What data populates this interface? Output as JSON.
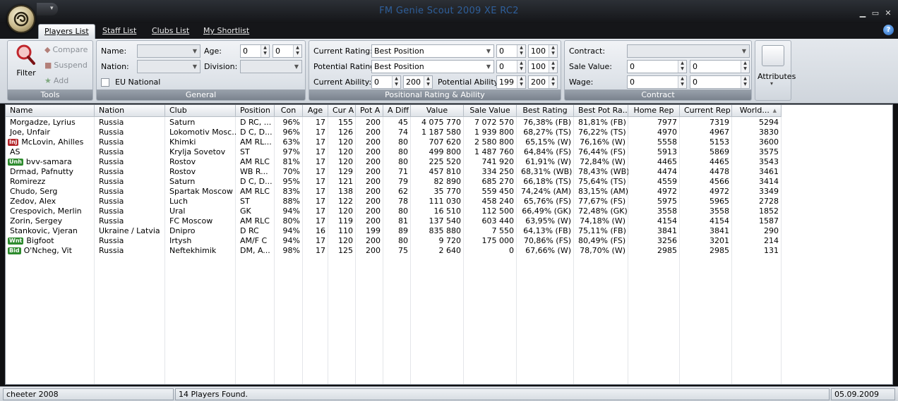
{
  "window": {
    "title": "FM Genie Scout 2009 XE RC2",
    "menu_arrow": "▾",
    "min": "▁",
    "restore": "▭",
    "close": "✕"
  },
  "tabs": [
    {
      "label": "Players List",
      "active": true
    },
    {
      "label": "Staff List"
    },
    {
      "label": "Clubs List"
    },
    {
      "label": "My Shortlist"
    }
  ],
  "help": "?",
  "ribbon": {
    "tools": {
      "caption": "Tools",
      "filter": "Filter",
      "compare": "Compare",
      "suspend": "Suspend",
      "add": "Add"
    },
    "general": {
      "caption": "General",
      "name_label": "Name:",
      "nation_label": "Nation:",
      "eu_label": "EU National",
      "age_label": "Age:",
      "age_min": "0",
      "age_max": "0",
      "division_label": "Division:"
    },
    "positional": {
      "caption": "Positional Rating & Ability",
      "current_rating_label": "Current Rating:",
      "current_rating_value": "Best Position",
      "cr_min": "0",
      "cr_max": "100",
      "potential_rating_label": "Potential Rating:",
      "potential_rating_value": "Best Position",
      "pr_min": "0",
      "pr_max": "100",
      "current_ability_label": "Current Ability:",
      "ca_min": "0",
      "ca_max": "200",
      "potential_ability_label": "Potential Ability:",
      "pa_min": "199",
      "pa_max": "200"
    },
    "contract": {
      "caption": "Contract",
      "contract_label": "Contract:",
      "sale_value_label": "Sale Value:",
      "sv_min": "0",
      "sv_max": "0",
      "wage_label": "Wage:",
      "w_min": "0",
      "w_max": "0"
    },
    "attributes": {
      "label": "Attributes",
      "arrow": "▾"
    }
  },
  "table": {
    "columns": [
      "Name",
      "Nation",
      "Club",
      "Position",
      "Con",
      "Age",
      "Cur A",
      "Pot A",
      "A Diff",
      "Value",
      "Sale Value",
      "Best Rating",
      "Best Pot Ra...",
      "Home Rep",
      "Current Rep",
      "World..."
    ],
    "sort_arrow": "▲",
    "rows": [
      {
        "badge": "",
        "name": "Morgadze, Lyrius",
        "nation": "Russia",
        "club": "Saturn",
        "position": "D RC, ...",
        "con": "96%",
        "age": "17",
        "cura": "155",
        "pota": "200",
        "adiff": "45",
        "value": "4 075 770",
        "sale": "7 072 570",
        "best": "76,38% (FB)",
        "bestpot": "81,81% (FB)",
        "home": "7977",
        "cur": "7319",
        "world": "5294"
      },
      {
        "badge": "",
        "name": "Joe, Unfair",
        "nation": "Russia",
        "club": "Lokomotiv Mosc...",
        "position": "D C, D...",
        "con": "96%",
        "age": "17",
        "cura": "126",
        "pota": "200",
        "adiff": "74",
        "value": "1 187 580",
        "sale": "1 939 800",
        "best": "68,27% (TS)",
        "bestpot": "76,22% (TS)",
        "home": "4970",
        "cur": "4967",
        "world": "3830"
      },
      {
        "badge": "Inj",
        "name": "McLovin, Ahilles",
        "nation": "Russia",
        "club": "Khimki",
        "position": "AM RL...",
        "con": "63%",
        "age": "17",
        "cura": "120",
        "pota": "200",
        "adiff": "80",
        "value": "707 620",
        "sale": "2 580 800",
        "best": "65,15% (W)",
        "bestpot": "76,16% (W)",
        "home": "5558",
        "cur": "5153",
        "world": "3600"
      },
      {
        "badge": "",
        "name": "AS",
        "nation": "Russia",
        "club": "Krylja Sovetov",
        "position": "ST",
        "con": "97%",
        "age": "17",
        "cura": "120",
        "pota": "200",
        "adiff": "80",
        "value": "499 800",
        "sale": "1 487 760",
        "best": "64,84% (FS)",
        "bestpot": "76,44% (FS)",
        "home": "5913",
        "cur": "5869",
        "world": "3575"
      },
      {
        "badge": "Unh",
        "name": "bvv-samara",
        "nation": "Russia",
        "club": "Rostov",
        "position": "AM RLC",
        "con": "81%",
        "age": "17",
        "cura": "120",
        "pota": "200",
        "adiff": "80",
        "value": "225 520",
        "sale": "741 920",
        "best": "61,91% (W)",
        "bestpot": "72,84% (W)",
        "home": "4465",
        "cur": "4465",
        "world": "3543"
      },
      {
        "badge": "",
        "name": "Drmad, Pafnutty",
        "nation": "Russia",
        "club": "Rostov",
        "position": "WB R...",
        "con": "70%",
        "age": "17",
        "cura": "129",
        "pota": "200",
        "adiff": "71",
        "value": "457 810",
        "sale": "334 250",
        "best": "68,31% (WB)",
        "bestpot": "78,43% (WB)",
        "home": "4474",
        "cur": "4478",
        "world": "3461"
      },
      {
        "badge": "",
        "name": "Romirezz",
        "nation": "Russia",
        "club": "Saturn",
        "position": "D C, D...",
        "con": "95%",
        "age": "17",
        "cura": "121",
        "pota": "200",
        "adiff": "79",
        "value": "82 890",
        "sale": "685 270",
        "best": "66,18% (TS)",
        "bestpot": "75,64% (TS)",
        "home": "4559",
        "cur": "4566",
        "world": "3414"
      },
      {
        "badge": "",
        "name": "Chudo, Serg",
        "nation": "Russia",
        "club": "Spartak Moscow",
        "position": "AM RLC",
        "con": "83%",
        "age": "17",
        "cura": "138",
        "pota": "200",
        "adiff": "62",
        "value": "35 770",
        "sale": "559 450",
        "best": "74,24% (AM)",
        "bestpot": "83,15% (AM)",
        "home": "4972",
        "cur": "4972",
        "world": "3349"
      },
      {
        "badge": "",
        "name": "Zedov, Alex",
        "nation": "Russia",
        "club": "Luch",
        "position": "ST",
        "con": "88%",
        "age": "17",
        "cura": "122",
        "pota": "200",
        "adiff": "78",
        "value": "111 030",
        "sale": "458 240",
        "best": "65,76% (FS)",
        "bestpot": "77,67% (FS)",
        "home": "5975",
        "cur": "5965",
        "world": "2728"
      },
      {
        "badge": "",
        "name": "Crespovich, Merlin",
        "nation": "Russia",
        "club": "Ural",
        "position": "GK",
        "con": "94%",
        "age": "17",
        "cura": "120",
        "pota": "200",
        "adiff": "80",
        "value": "16 510",
        "sale": "112 500",
        "best": "66,49% (GK)",
        "bestpot": "72,48% (GK)",
        "home": "3558",
        "cur": "3558",
        "world": "1852"
      },
      {
        "badge": "",
        "name": "Zorin, Sergey",
        "nation": "Russia",
        "club": "FC Moscow",
        "position": "AM RLC",
        "con": "80%",
        "age": "17",
        "cura": "119",
        "pota": "200",
        "adiff": "81",
        "value": "137 540",
        "sale": "603 440",
        "best": "63,95% (W)",
        "bestpot": "74,18% (W)",
        "home": "4154",
        "cur": "4154",
        "world": "1587"
      },
      {
        "badge": "",
        "name": "Stankovic, Vjeran",
        "nation": "Ukraine / Latvia",
        "club": "Dnipro",
        "position": "D RC",
        "con": "94%",
        "age": "16",
        "cura": "110",
        "pota": "199",
        "adiff": "89",
        "value": "835 880",
        "sale": "7 550",
        "best": "64,13% (FB)",
        "bestpot": "75,11% (FB)",
        "home": "3841",
        "cur": "3841",
        "world": "290"
      },
      {
        "badge": "Wnt",
        "name": "Bigfoot",
        "nation": "Russia",
        "club": "Irtysh",
        "position": "AM/F C",
        "con": "94%",
        "age": "17",
        "cura": "120",
        "pota": "200",
        "adiff": "80",
        "value": "9 720",
        "sale": "175 000",
        "best": "70,86% (FS)",
        "bestpot": "80,49% (FS)",
        "home": "3256",
        "cur": "3201",
        "world": "214"
      },
      {
        "badge": "Bid",
        "name": "O'Ncheg, Vit",
        "nation": "Russia",
        "club": "Neftekhimik",
        "position": "DM, A...",
        "con": "98%",
        "age": "17",
        "cura": "125",
        "pota": "200",
        "adiff": "75",
        "value": "2 640",
        "sale": "0",
        "best": "67,66% (W)",
        "bestpot": "78,70% (W)",
        "home": "2985",
        "cur": "2985",
        "world": "131"
      }
    ]
  },
  "badge_colors": {
    "Inj": "#b3262b",
    "Unh": "#2e8b2e",
    "Wnt": "#2e8b2e",
    "Bid": "#2e8b2e"
  },
  "status": {
    "left": "cheeter 2008",
    "middle": "14 Players Found.",
    "right": "05.09.2009"
  }
}
